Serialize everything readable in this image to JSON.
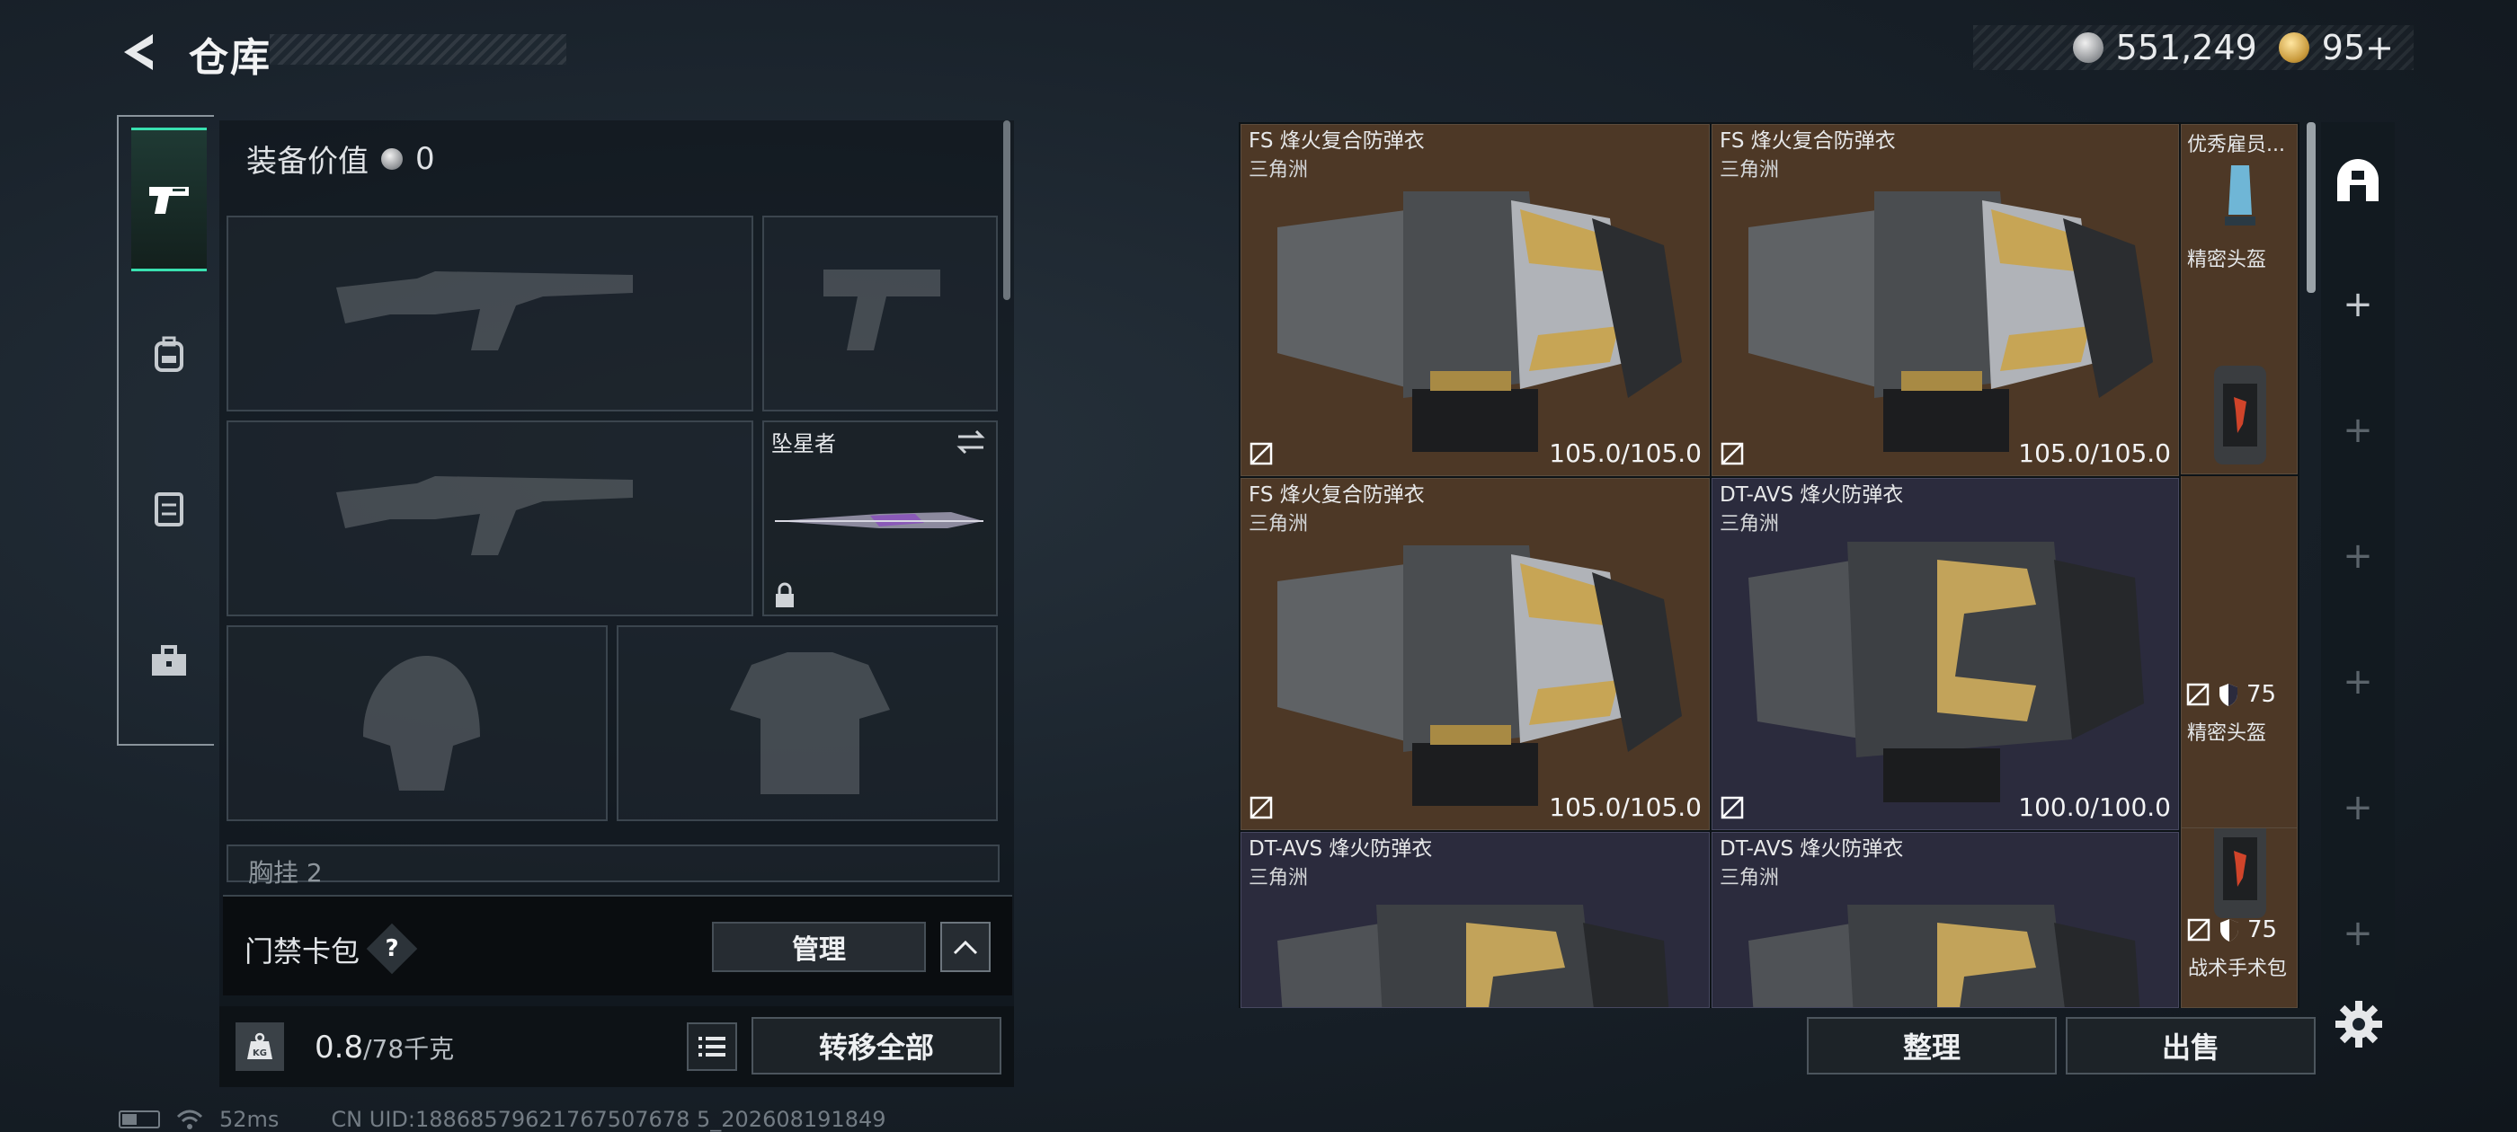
{
  "header": {
    "title": "仓库"
  },
  "currency": [
    {
      "icon": "silver-coin-icon",
      "value": "551,249"
    },
    {
      "icon": "gold-coin-icon",
      "value": "95+"
    }
  ],
  "left_nav": [
    {
      "icon": "pistol-icon",
      "active": true
    },
    {
      "icon": "backpack-icon",
      "active": false
    },
    {
      "icon": "vest-icon",
      "active": false
    },
    {
      "icon": "toolbox-icon",
      "active": false
    }
  ],
  "equipment": {
    "value_label": "装备价值",
    "value": "0",
    "melee_name": "坠星者",
    "chest_label": "胸挂",
    "chest_count": "2"
  },
  "access_card": {
    "label": "门禁卡包",
    "help": "?",
    "manage": "管理"
  },
  "weight": {
    "current": "0.8",
    "max": "/78千克"
  },
  "transfer_all": "转移全部",
  "status": {
    "ping": "52ms",
    "uid": "CN UID:18868579621767507678 5_202608191849"
  },
  "storage": {
    "items": [
      {
        "name": "FS 烽火复合防弹衣",
        "category": "三角洲",
        "durability": "105.0/105.0"
      },
      {
        "name": "FS 烽火复合防弹衣",
        "category": "三角洲",
        "durability": "105.0/105.0"
      },
      {
        "name": "FS 烽火复合防弹衣",
        "category": "三角洲",
        "durability": "105.0/105.0"
      },
      {
        "name": "DT-AVS 烽火防弹衣",
        "category": "三角洲",
        "durability": "100.0/100.0"
      },
      {
        "name": "DT-AVS 烽火防弹衣",
        "category": "三角洲",
        "durability": ""
      },
      {
        "name": "DT-AVS 烽火防弹衣",
        "category": "三角洲",
        "durability": ""
      }
    ],
    "side_items": [
      {
        "label": "优秀雇员..."
      },
      {
        "label": "精密头盔"
      },
      {
        "label": "精密头盔",
        "armor": "75"
      },
      {
        "label": "战术手术包",
        "armor": "75"
      }
    ]
  },
  "actions": {
    "sort": "整理",
    "sell": "出售"
  }
}
